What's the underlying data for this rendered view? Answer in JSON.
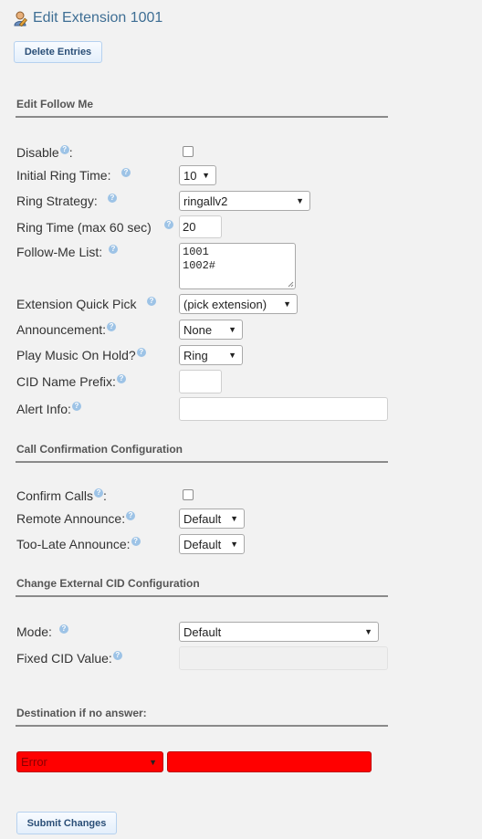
{
  "header": {
    "title": "Edit Extension 1001",
    "icon": "user-edit-icon"
  },
  "buttons": {
    "delete": "Delete Entries",
    "submit": "Submit Changes"
  },
  "sections": {
    "follow_me": "Edit Follow Me",
    "call_confirmation": "Call Confirmation Configuration",
    "external_cid": "Change External CID Configuration",
    "destination": "Destination if no answer:"
  },
  "fields": {
    "disable": {
      "label": "Disable",
      "suffix": ":",
      "checked": false
    },
    "initial_ring_time": {
      "label": "Initial Ring Time:",
      "value": "10"
    },
    "ring_strategy": {
      "label": "Ring Strategy:",
      "value": "ringallv2"
    },
    "ring_time": {
      "label": "Ring Time (max 60 sec)",
      "value": "20"
    },
    "follow_me_list": {
      "label": "Follow-Me List:",
      "value": "1001\n1002#"
    },
    "extension_quick_pick": {
      "label": "Extension Quick Pick",
      "value": "(pick extension)"
    },
    "announcement": {
      "label": "Announcement:",
      "value": "None"
    },
    "music_on_hold": {
      "label": "Play Music On Hold?",
      "value": "Ring"
    },
    "cid_name_prefix": {
      "label": "CID Name Prefix:",
      "value": ""
    },
    "alert_info": {
      "label": "Alert Info:",
      "value": ""
    },
    "confirm_calls": {
      "label": "Confirm Calls",
      "suffix": ":",
      "checked": false
    },
    "remote_announce": {
      "label": "Remote Announce:",
      "value": "Default"
    },
    "too_late_announce": {
      "label": "Too-Late Announce:",
      "value": "Default"
    },
    "mode": {
      "label": "Mode:",
      "value": "Default"
    },
    "fixed_cid_value": {
      "label": "Fixed CID Value:",
      "value": ""
    }
  },
  "destination": {
    "type": "Error",
    "value": ""
  },
  "help_glyph": "?",
  "colors": {
    "accent": "#3e6e94",
    "error": "#ff0000",
    "help": "#9dc3e6"
  }
}
